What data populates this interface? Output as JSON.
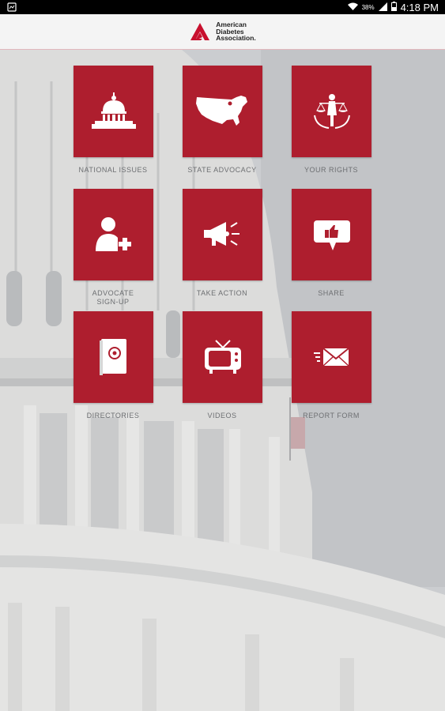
{
  "status_bar": {
    "time": "4:18 PM",
    "battery": "38%"
  },
  "app_bar": {
    "logo_lines": [
      "American",
      "Diabetes",
      "Association."
    ]
  },
  "colors": {
    "tile": "#ae1e2e",
    "label": "#6d6f72"
  },
  "tiles": [
    {
      "label": "NATIONAL ISSUES",
      "icon": "capitol-icon"
    },
    {
      "label": "STATE ADVOCACY",
      "icon": "usa-map-icon"
    },
    {
      "label": "YOUR RIGHTS",
      "icon": "justice-icon"
    },
    {
      "label": "ADVOCATE SIGN-UP",
      "icon": "add-person-icon"
    },
    {
      "label": "TAKE ACTION",
      "icon": "megaphone-icon"
    },
    {
      "label": "SHARE",
      "icon": "thumbs-up-bubble-icon"
    },
    {
      "label": "DIRECTORIES",
      "icon": "address-book-icon"
    },
    {
      "label": "VIDEOS",
      "icon": "tv-icon"
    },
    {
      "label": "REPORT FORM",
      "icon": "envelope-icon"
    }
  ]
}
